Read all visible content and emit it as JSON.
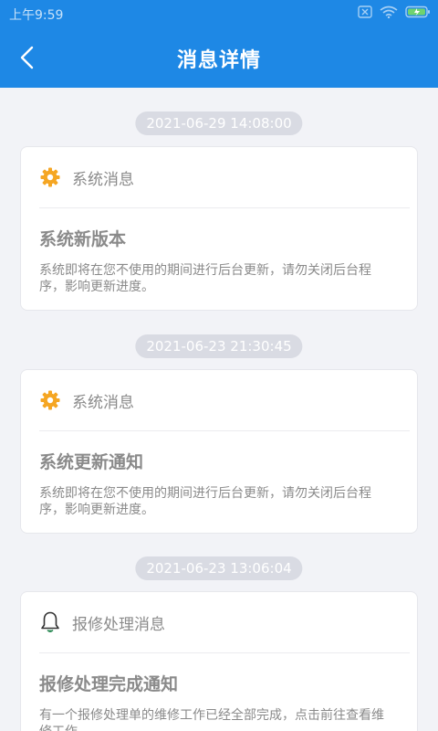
{
  "status_bar": {
    "time": "上午9:59"
  },
  "header": {
    "title": "消息详情"
  },
  "messages": [
    {
      "timestamp": "2021-06-29 14:08:00",
      "category": "系统消息",
      "icon": "gear-icon",
      "title": "系统新版本",
      "body": "系统即将在您不使用的期间进行后台更新，请勿关闭后台程序，影响更新进度。"
    },
    {
      "timestamp": "2021-06-23 21:30:45",
      "category": "系统消息",
      "icon": "gear-icon",
      "title": "系统更新通知",
      "body": "系统即将在您不使用的期间进行后台更新，请勿关闭后台程序，影响更新进度。"
    },
    {
      "timestamp": "2021-06-23 13:06:04",
      "category": "报修处理消息",
      "icon": "bell-icon",
      "title": "报修处理完成通知",
      "body": "有一个报修处理单的维修工作已经全部完成，点击前往查看维修工作"
    }
  ],
  "colors": {
    "header_bg": "#1e88e5",
    "gear_icon": "#f5a623",
    "bell_icon": "#2e8b57",
    "page_bg": "#f2f3f7"
  }
}
